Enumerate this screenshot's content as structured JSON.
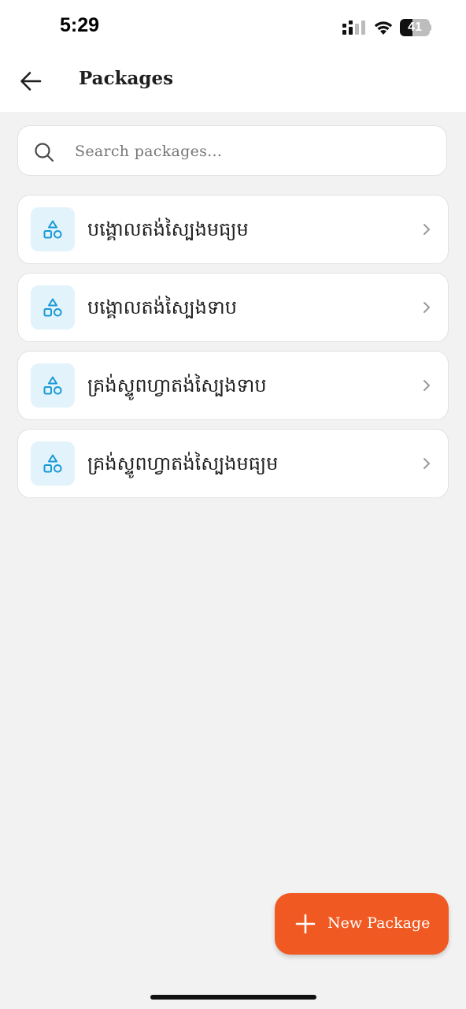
{
  "status_bar": {
    "time": "5:29",
    "battery_level": "41"
  },
  "header": {
    "title": "Packages",
    "back_icon": "arrow-left-icon"
  },
  "search": {
    "placeholder": "Search packages...",
    "value": "",
    "icon": "search-icon"
  },
  "packages": [
    {
      "label": "បង្គោលតង់ស្បៃងមធ្យម",
      "icon": "shapes-icon"
    },
    {
      "label": "បង្គោលតង់ស្បៃងទាប",
      "icon": "shapes-icon"
    },
    {
      "label": "គ្រង់ស្ទូពហ្វាតង់ស្បៃងទាប",
      "icon": "shapes-icon"
    },
    {
      "label": "គ្រង់ស្ទូពហ្វាតង់ស្បៃងមធ្យម",
      "icon": "shapes-icon"
    }
  ],
  "fab": {
    "label": "New Package",
    "icon": "plus-icon"
  },
  "colors": {
    "accent": "#f05a22",
    "icon_blue": "#1a9ad6",
    "icon_bg": "#e2f3fc",
    "background": "#f2f2f2"
  }
}
